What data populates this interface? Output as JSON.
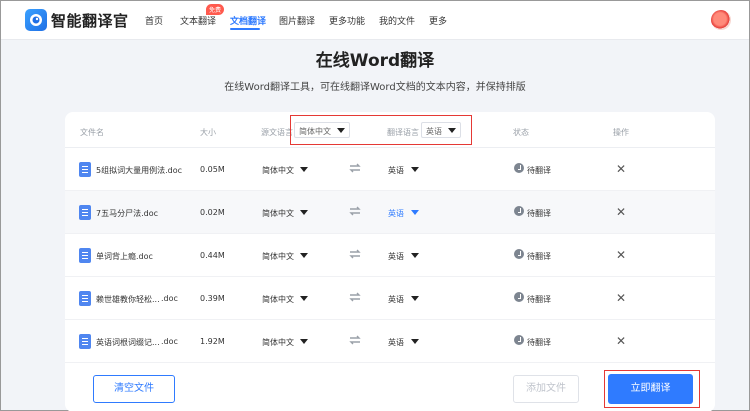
{
  "header": {
    "app_name": "智能翻译官",
    "nav": [
      {
        "label": "首页"
      },
      {
        "label": "文本翻译"
      },
      {
        "label": "文档翻译",
        "active": true
      },
      {
        "label": "图片翻译"
      },
      {
        "label": "更多功能"
      },
      {
        "label": "我的文件"
      },
      {
        "label": "更多"
      }
    ],
    "badge": "免费"
  },
  "page": {
    "title": "在线Word翻译",
    "subtitle": "在线Word翻译工具，可在线翻译Word文档的文本内容，并保持排版"
  },
  "table": {
    "columns": {
      "filename": "文件名",
      "size": "大小",
      "source_lang": "源文语言",
      "target_lang": "翻译语言",
      "status": "状态",
      "action": "操作"
    },
    "header_source_value": "简体中文",
    "header_target_value": "英语",
    "rows": [
      {
        "filename": "5组拟词大量用例法.doc",
        "size": "0.05M",
        "source": "简体中文",
        "target": "英语",
        "status": "待翻译"
      },
      {
        "filename": "7五马分尸法.doc",
        "size": "0.02M",
        "source": "简体中文",
        "target": "英语",
        "status": "待翻译"
      },
      {
        "filename": "单词背上瘾.doc",
        "size": "0.44M",
        "source": "简体中文",
        "target": "英语",
        "status": "待翻译"
      },
      {
        "filename": "赖世雄教你轻松...",
        "filename_ext": ".doc",
        "size": "0.39M",
        "source": "简体中文",
        "target": "英语",
        "status": "待翻译"
      },
      {
        "filename": "英语词根词缀记...",
        "filename_ext": ".doc",
        "size": "1.92M",
        "source": "简体中文",
        "target": "英语",
        "status": "待翻译"
      }
    ]
  },
  "buttons": {
    "clear": "清空文件",
    "add": "添加文件",
    "translate": "立即翻译"
  },
  "colors": {
    "accent": "#2f7bff",
    "highlight": "#e53935"
  }
}
